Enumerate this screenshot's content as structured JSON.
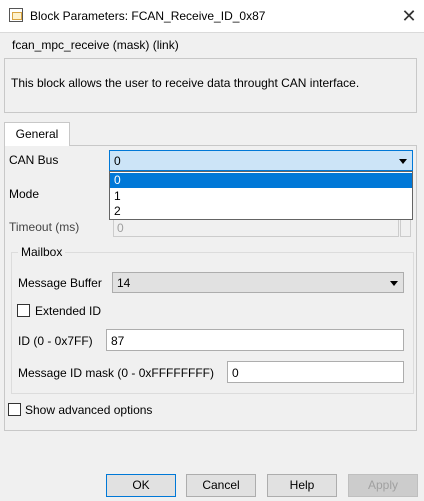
{
  "window": {
    "title": "Block Parameters: FCAN_Receive_ID_0x87",
    "close_glyph": "✕"
  },
  "mask": {
    "title": "fcan_mpc_receive (mask) (link)",
    "description": "This block allows the user to receive data throught CAN interface."
  },
  "tabs": [
    {
      "label": "General"
    }
  ],
  "can_bus": {
    "label": "CAN Bus",
    "value": "0",
    "options": [
      "0",
      "1",
      "2"
    ],
    "highlighted_option": "0"
  },
  "mode": {
    "label": "Mode"
  },
  "timeout": {
    "label": "Timeout (ms)",
    "value": "0"
  },
  "mailbox": {
    "title": "Mailbox",
    "message_buffer": {
      "label": "Message Buffer",
      "value": "14"
    },
    "extended_id": {
      "label": "Extended ID",
      "checked": false
    },
    "id": {
      "label": "ID (0 - 0x7FF)",
      "value": "87"
    },
    "id_mask": {
      "label": "Message ID mask (0 - 0xFFFFFFFF)",
      "value": "0"
    }
  },
  "advanced": {
    "label": "Show advanced options",
    "checked": false
  },
  "buttons": {
    "ok": "OK",
    "cancel": "Cancel",
    "help": "Help",
    "apply": "Apply"
  },
  "colors": {
    "selection": "#0078d7",
    "combo_active": "#cce4f7",
    "background": "#f0f0f0"
  }
}
